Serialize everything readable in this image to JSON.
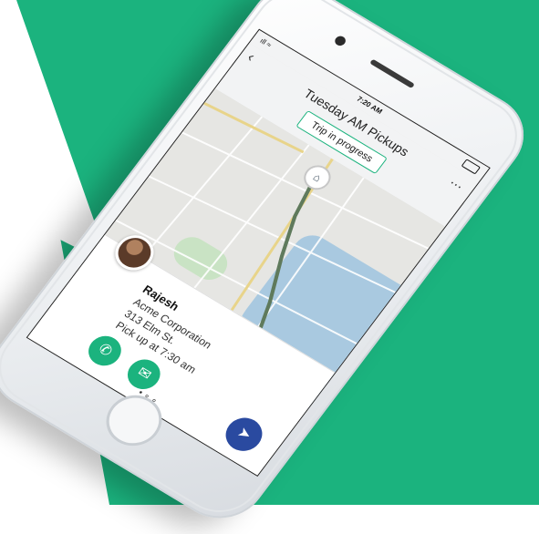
{
  "status_bar": {
    "time": "7:20 AM",
    "signal": "ıll ≈"
  },
  "header": {
    "back_icon": "chevron-left-icon",
    "title": "Tuesday AM Pickups",
    "more_icon": "more-icon",
    "status_pill": "Trip in progress"
  },
  "pickup": {
    "name": "Rajesh",
    "company": "Acme Corporation",
    "address": "313 Elm St.",
    "pickup_time": "Pick up at 7:30 am"
  },
  "actions": {
    "call_icon": "phone-icon",
    "message_icon": "chat-icon",
    "navigate_icon": "navigate-icon"
  },
  "pager": "•∘∘",
  "colors": {
    "brand_green": "#1bb37e",
    "nav_blue": "#2a4aa0",
    "background": "#ffffff"
  }
}
